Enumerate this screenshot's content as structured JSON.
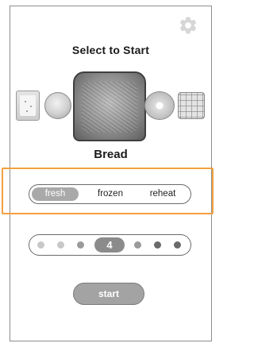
{
  "header": {
    "title": "Select to Start",
    "settings_icon": "gear-icon"
  },
  "foods": {
    "items": [
      "poptart",
      "english-muffin",
      "bread",
      "bagel",
      "waffle"
    ],
    "selected_label": "Bread"
  },
  "mode": {
    "options": [
      "fresh",
      "frozen",
      "reheat"
    ],
    "selected": "fresh"
  },
  "doneness": {
    "selected": "4"
  },
  "actions": {
    "start_label": "start"
  },
  "colors": {
    "highlight": "#f2a03f",
    "selected_pill": "#a9a9a9",
    "start_button": "#a3a3a3"
  }
}
